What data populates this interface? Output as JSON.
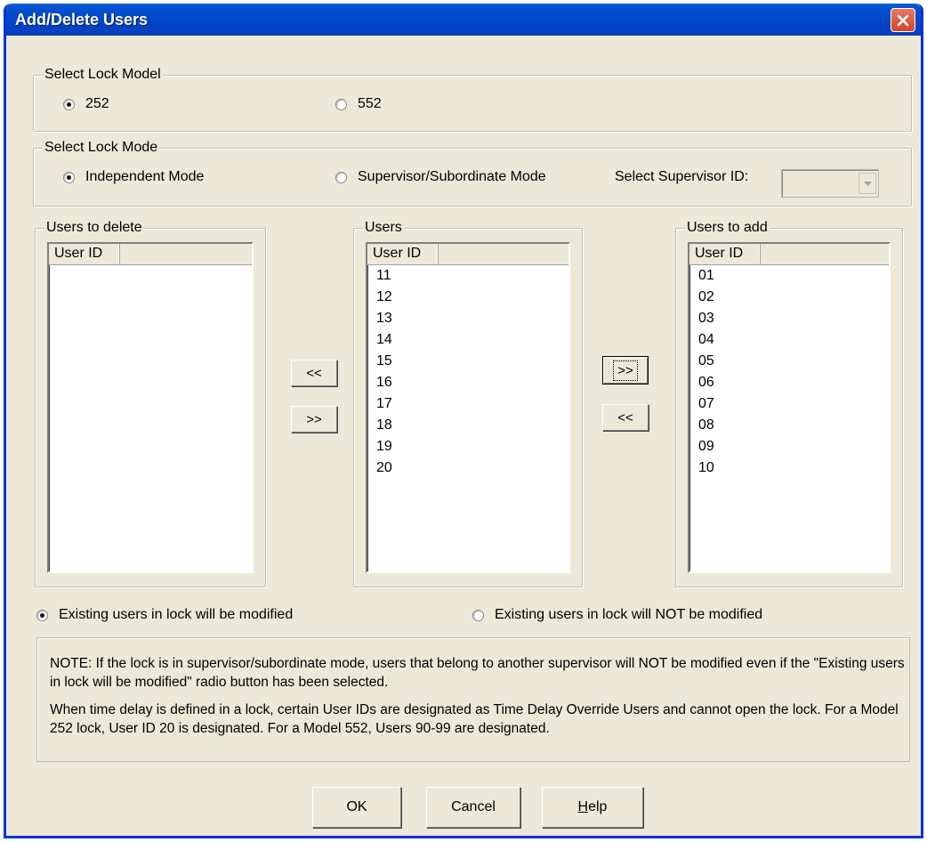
{
  "window": {
    "title": "Add/Delete Users"
  },
  "lock_model": {
    "legend": "Select Lock Model",
    "options": [
      {
        "label": "252",
        "checked": true
      },
      {
        "label": "552",
        "checked": false
      }
    ]
  },
  "lock_mode": {
    "legend": "Select Lock Mode",
    "options": [
      {
        "label": "Independent Mode",
        "checked": true
      },
      {
        "label": "Supervisor/Subordinate Mode",
        "checked": false
      }
    ],
    "supervisor_label": "Select Supervisor ID:",
    "supervisor_value": ""
  },
  "lists": {
    "delete": {
      "legend": "Users to delete",
      "column": "User ID",
      "items": []
    },
    "users": {
      "legend": "Users",
      "column": "User ID",
      "items": [
        "11",
        "12",
        "13",
        "14",
        "15",
        "16",
        "17",
        "18",
        "19",
        "20"
      ]
    },
    "add": {
      "legend": "Users to add",
      "column": "User ID",
      "items": [
        "01",
        "02",
        "03",
        "04",
        "05",
        "06",
        "07",
        "08",
        "09",
        "10"
      ]
    }
  },
  "transfer_buttons": {
    "left_pair": [
      "<<",
      ">>"
    ],
    "right_pair": [
      ">>",
      "<<"
    ]
  },
  "modify_options": [
    {
      "label": "Existing users in lock will be modified",
      "checked": true
    },
    {
      "label": "Existing users in lock will NOT be modified",
      "checked": false
    }
  ],
  "note": {
    "p1": "NOTE: If the lock is in supervisor/subordinate mode, users that belong to another supervisor will NOT be modified even if the \"Existing users in lock will be modified\" radio button has been selected.",
    "p2": "When time delay is defined in a lock, certain User IDs are designated as Time Delay Override Users and cannot open the lock. For a Model 252 lock, User ID 20 is designated. For a Model 552, Users 90-99 are designated."
  },
  "footer": {
    "ok": "OK",
    "cancel": "Cancel",
    "help_first": "H",
    "help_rest": "elp"
  }
}
